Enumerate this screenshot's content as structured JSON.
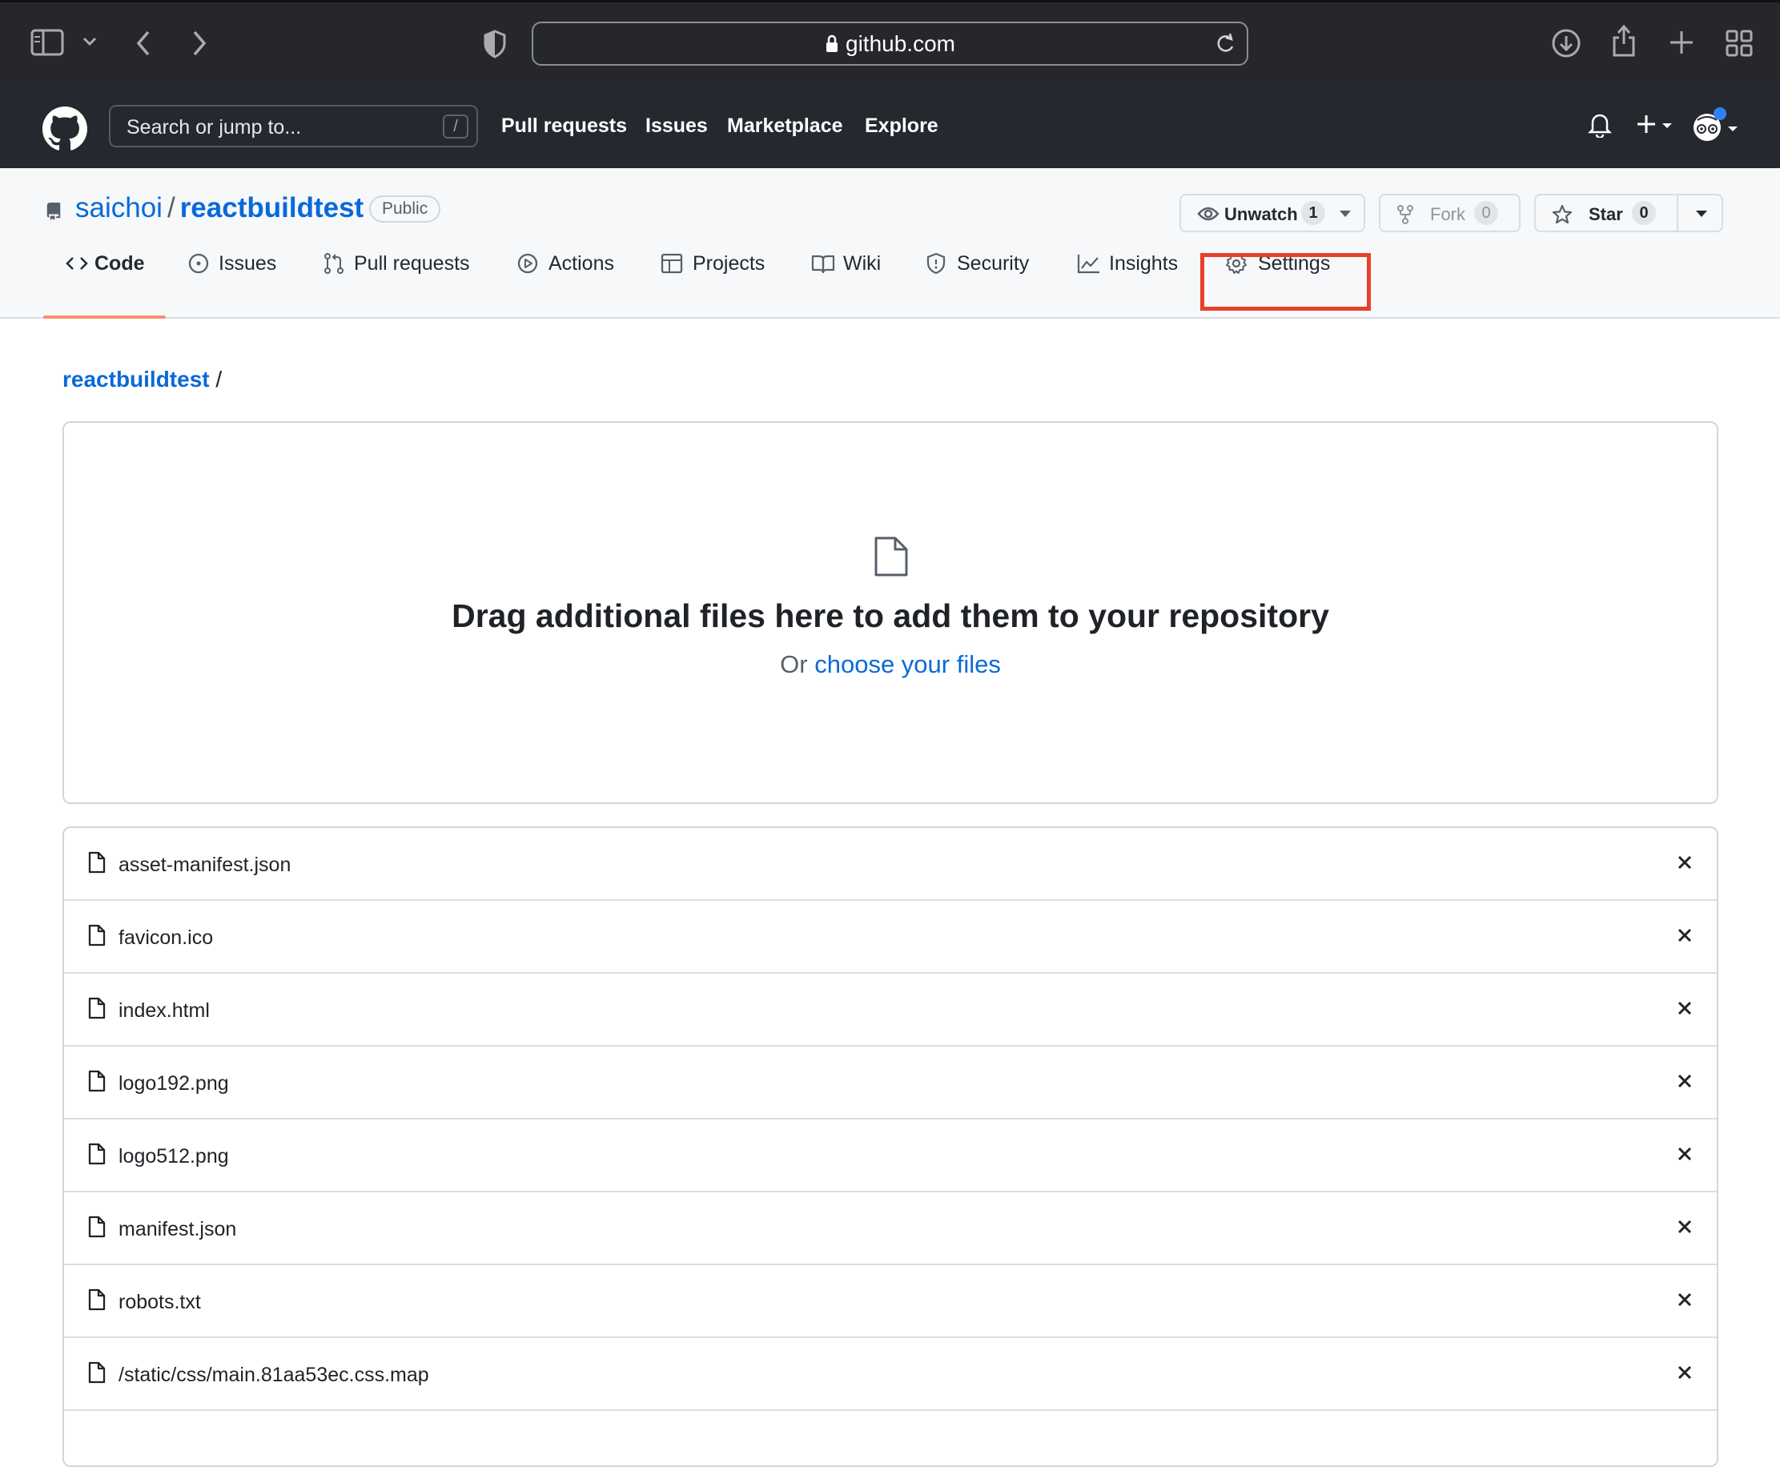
{
  "browser": {
    "url": "github.com"
  },
  "header": {
    "search_placeholder": "Search or jump to...",
    "search_shortcut": "/",
    "nav": [
      "Pull requests",
      "Issues",
      "Marketplace",
      "Explore"
    ]
  },
  "repo": {
    "owner": "saichoi",
    "name": "reactbuildtest",
    "separator": "/",
    "visibility": "Public",
    "unwatch_label": "Unwatch",
    "watch_count": "1",
    "fork_label": "Fork",
    "fork_count": "0",
    "star_label": "Star",
    "star_count": "0"
  },
  "tabs": [
    {
      "label": "Code",
      "icon": "code-icon",
      "selected": true
    },
    {
      "label": "Issues",
      "icon": "issue-icon"
    },
    {
      "label": "Pull requests",
      "icon": "pull-request-icon"
    },
    {
      "label": "Actions",
      "icon": "play-icon"
    },
    {
      "label": "Projects",
      "icon": "table-icon"
    },
    {
      "label": "Wiki",
      "icon": "book-icon"
    },
    {
      "label": "Security",
      "icon": "shield-icon"
    },
    {
      "label": "Insights",
      "icon": "graph-icon"
    },
    {
      "label": "Settings",
      "icon": "gear-icon",
      "highlighted": true
    }
  ],
  "breadcrumb": {
    "repo": "reactbuildtest",
    "sep": "/"
  },
  "dropzone": {
    "title": "Drag additional files here to add them to your repository",
    "or_text": "Or",
    "link_text": "choose your files"
  },
  "files": [
    "asset-manifest.json",
    "favicon.ico",
    "index.html",
    "logo192.png",
    "logo512.png",
    "manifest.json",
    "robots.txt",
    "/static/css/main.81aa53ec.css.map"
  ],
  "colors": {
    "accent_link": "#0969da",
    "highlight_box": "#e8402d",
    "tab_underline": "#fd8c73"
  }
}
